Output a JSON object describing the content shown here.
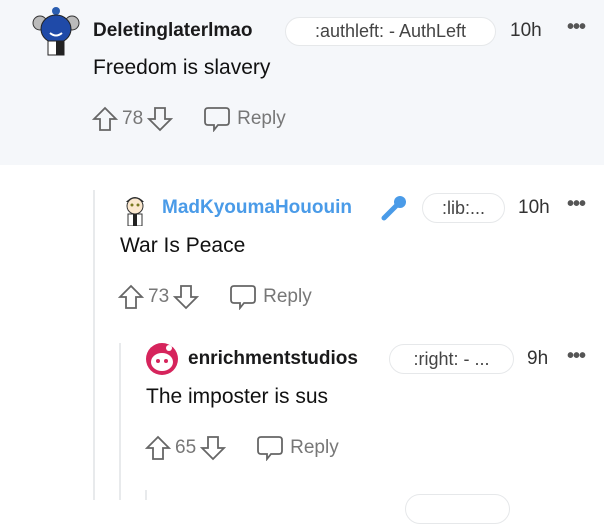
{
  "comments": [
    {
      "username": "Deletinglaterlmao",
      "flair": ":authleft: - AuthLeft",
      "time": "10h",
      "more": "•••",
      "body": "Freedom is slavery",
      "votes": "78",
      "reply": "Reply",
      "username_color": "#1a1a1b"
    },
    {
      "username": "MadKyoumaHououin",
      "flair": ":lib:...",
      "time": "10h",
      "more": "•••",
      "body": "War Is Peace",
      "votes": "73",
      "reply": "Reply",
      "username_color": "#4a9be8",
      "badge_icon": "microphone-icon"
    },
    {
      "username": "enrichmentstudios",
      "flair": ":right: - ...",
      "time": "9h",
      "more": "•••",
      "body": "The imposter is sus",
      "votes": "65",
      "reply": "Reply",
      "username_color": "#1a1a1b"
    }
  ]
}
